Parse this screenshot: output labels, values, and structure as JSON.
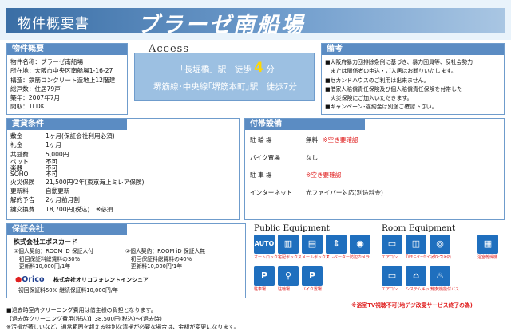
{
  "header": {
    "subtitle": "物件概要書",
    "property_name": "ブラーゼ南船場"
  },
  "overview": {
    "title": "物件概要",
    "lines": [
      "物件名称：ブラーゼ南船場",
      "所在地：大阪市中央区南船場1-16-27",
      "構造：鉄筋コンクリート造地上12階建",
      "総戸数：住居79戸",
      "築年：2007年7月",
      "間取：1LDK"
    ]
  },
  "access": {
    "title": "Access",
    "line1_pre": "「長堀橋」駅　徒歩",
    "line1_num": "4",
    "line1_post": "分",
    "line2": "堺筋線･中央線｢堺筋本町｣駅　徒歩7分"
  },
  "notes": {
    "title": "備考",
    "items": [
      "■大阪府暴力団排除条例に基づき、暴力団員等、反社会勢力",
      "　または関係者の申込・ご入居はお断りいたします。",
      "■セカンドハウスのご利用は出来ません。",
      "■借家人賠償責任保険及び個人賠償責任保険を付帯した",
      "　火災保険にご加入いただきます。",
      "■キャンペーン･違約金は別途ご確認下さい。"
    ]
  },
  "rent": {
    "title": "賃貸条件",
    "rows": [
      {
        "label": "敷金",
        "value": "1ヶ月(保証会社利用必須)"
      },
      {
        "label": "礼金",
        "value": "1ヶ月"
      },
      {
        "label": "共益費",
        "value": "5,000円"
      },
      {
        "label": "ペット",
        "value": "不可"
      },
      {
        "label": "楽器",
        "value": "不可"
      },
      {
        "label": "SOHO",
        "value": "不可"
      },
      {
        "label": "火災保険",
        "value": "21,500円/2年(東京海上ミレア保険)"
      },
      {
        "label": "更新料",
        "value": "自動更新"
      },
      {
        "label": "解約予告",
        "value": "2ヶ月前月割"
      },
      {
        "label": "鍵交換費",
        "value": "18,700円(税込)　※必須"
      }
    ]
  },
  "facilities": {
    "title": "付帯設備",
    "rows": [
      {
        "label": "駐 輪 場",
        "value": "無料",
        "note": "※空き要確認"
      },
      {
        "label": "バイク置場",
        "value": "なし",
        "note": ""
      },
      {
        "label": "駐 車 場",
        "value": "",
        "note": "※空き要確認"
      },
      {
        "label": "インターネット",
        "value": "光ファイバー対応(別途料金)",
        "note": ""
      }
    ]
  },
  "guarantee": {
    "title": "保証会社",
    "company1": "株式会社エポスカード",
    "plan1": [
      "①個人契約：ROOM iD  保証人付",
      "　初回保証料総賃料の30%",
      "　更新料10,000円/1年"
    ],
    "plan2": [
      "②個人契約：ROOM iD  保証人無",
      "　初回保証料総賃料の40%",
      "　更新料10,000円/1年"
    ],
    "company2_logo": "Orico",
    "company2": "株式会社オリコフォレントインシュア",
    "plan3": "初回保証料50%  継続保証料10,000円/年"
  },
  "equipment": {
    "public_title": "Public Equipment",
    "room_title": "Room Equipment",
    "public_icons": [
      {
        "glyph": "AUTO",
        "icon": "autolock-icon",
        "caption": "オートロック"
      },
      {
        "glyph": "▥",
        "icon": "delivery-box-icon",
        "caption": "宅配ボックス"
      },
      {
        "glyph": "▤",
        "icon": "mailbox-icon",
        "caption": "メールボックス"
      },
      {
        "glyph": "⇕",
        "icon": "elevator-icon",
        "caption": "エレベーター"
      },
      {
        "glyph": "◉",
        "icon": "security-camera-icon",
        "caption": "防犯カメラ"
      },
      {
        "glyph": "P",
        "icon": "parking-icon",
        "caption": "駐車場"
      },
      {
        "glyph": "⚲",
        "icon": "bicycle-icon",
        "caption": "駐輪場"
      },
      {
        "glyph": "P",
        "icon": "bike-parking-icon",
        "caption": "バイク置場"
      }
    ],
    "room_icons": [
      {
        "glyph": "▭",
        "icon": "air-conditioner-icon",
        "caption": "エアコン"
      },
      {
        "glyph": "◫",
        "icon": "tv-monitor-icon",
        "caption": "TVモニター付インターフォン"
      },
      {
        "glyph": "◎",
        "icon": "gas-stove-icon",
        "caption": "ガスコンロ"
      },
      {
        "glyph": "▦",
        "icon": "bath-dryer-icon",
        "caption": "浴室乾燥機"
      },
      {
        "glyph": "▭",
        "icon": "aircon-2-icon",
        "caption": "エアコン"
      },
      {
        "glyph": "⌂",
        "icon": "system-kitchen-icon",
        "caption": "システムキッチン"
      },
      {
        "glyph": "♨",
        "icon": "reheating-bath-icon",
        "caption": "追焚機能付バス"
      }
    ],
    "note": "※浴室TV視聴不可(地デジ改変サービス終了の為)"
  },
  "footer": {
    "lines": [
      "■退去時室内クリーニング費用は借主様の負担となります。",
      "【退去時クリーニング費用(税込)】38,500円(税込)～(退去時)",
      "※汚損が著しいなど、通常範囲を超える特別な清掃が必要な場合は、金額が変更になります。"
    ]
  },
  "colors": {
    "accent": "#5b8cc3",
    "icon_blue": "#1f6fbe",
    "warning": "#e02020"
  }
}
